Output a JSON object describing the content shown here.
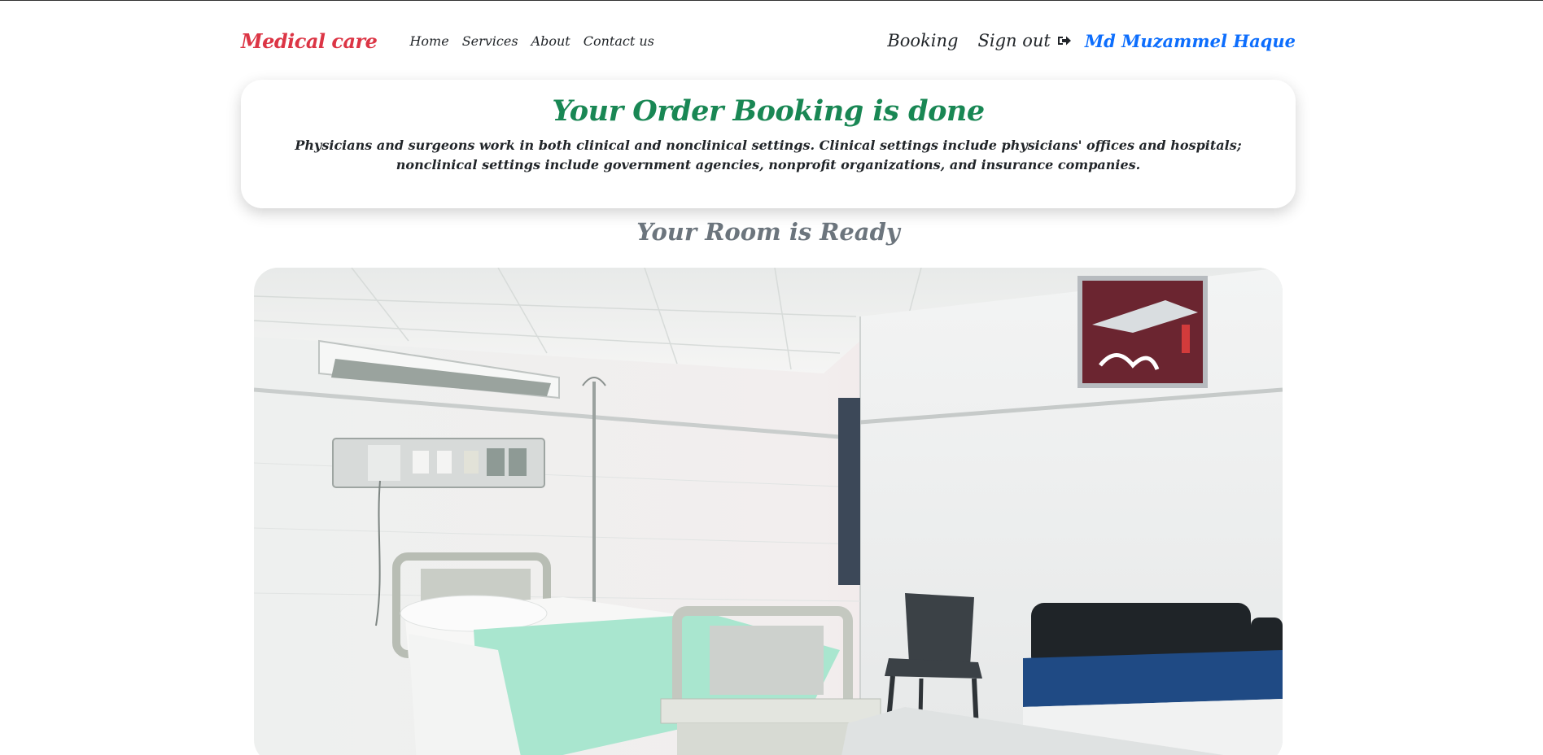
{
  "navbar": {
    "brand": "Medical care",
    "links": [
      "Home",
      "Services",
      "About",
      "Contact us"
    ],
    "booking": "Booking",
    "signout": "Sign out",
    "username": "Md Muzammel Haque"
  },
  "order": {
    "title": "Your Order Booking is done",
    "description": "Physicians and surgeons work in both clinical and nonclinical settings. Clinical settings include physicians' offices and hospitals; nonclinical settings include government agencies, nonprofit organizations, and insurance companies."
  },
  "room": {
    "title": "Your Room is Ready",
    "image": "hospital-room-photo"
  },
  "colors": {
    "brand": "#dc3545",
    "success": "#198754",
    "link": "#0d6efd",
    "muted": "#6c757d"
  }
}
